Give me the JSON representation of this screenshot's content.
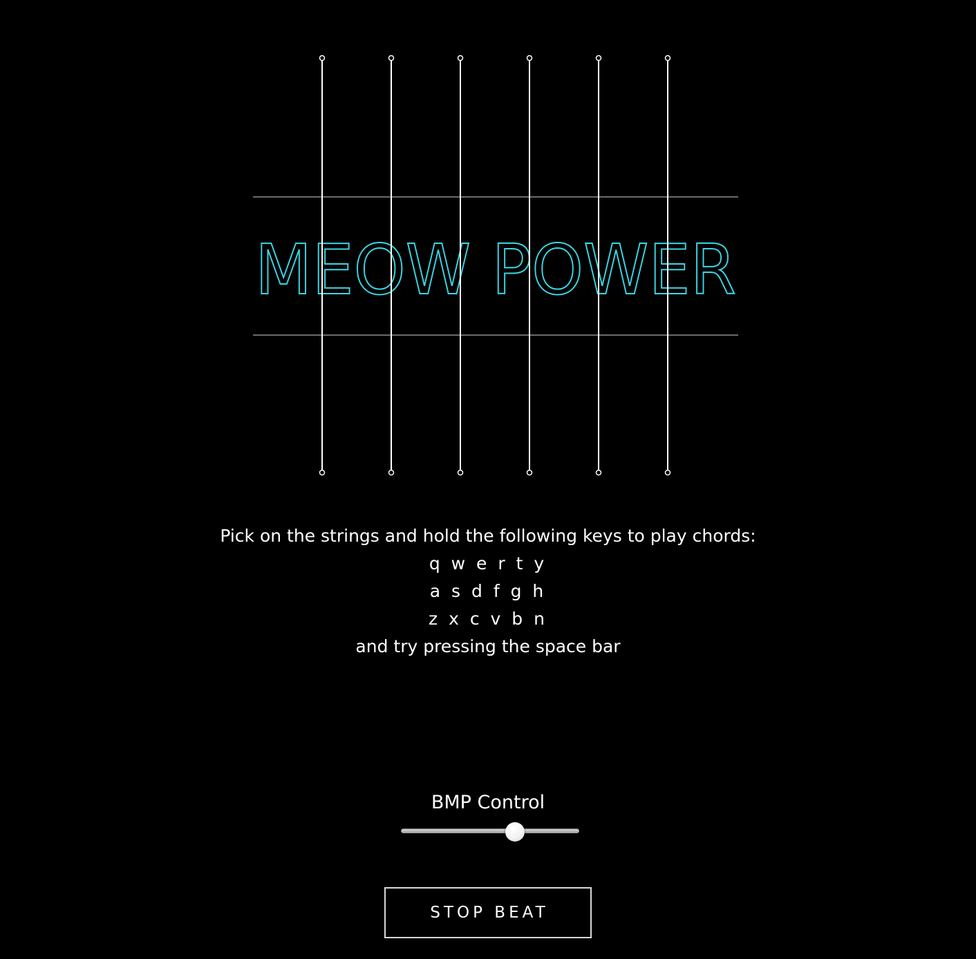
{
  "title": "MEOW POWER",
  "accent_color": "#3ad7e6",
  "string_color": "#ffffff",
  "fret_color": "#6b6b6b",
  "instructions": {
    "intro": "Pick on the strings and hold the following keys to play chords:",
    "row1": "q w e r t y",
    "row2": "a s d f g h",
    "row3": "z x c v b n",
    "outro": "and try pressing the space bar"
  },
  "bpm": {
    "label": "BMP Control",
    "level": 0.64
  },
  "stop_button_label": "STOP BEAT"
}
